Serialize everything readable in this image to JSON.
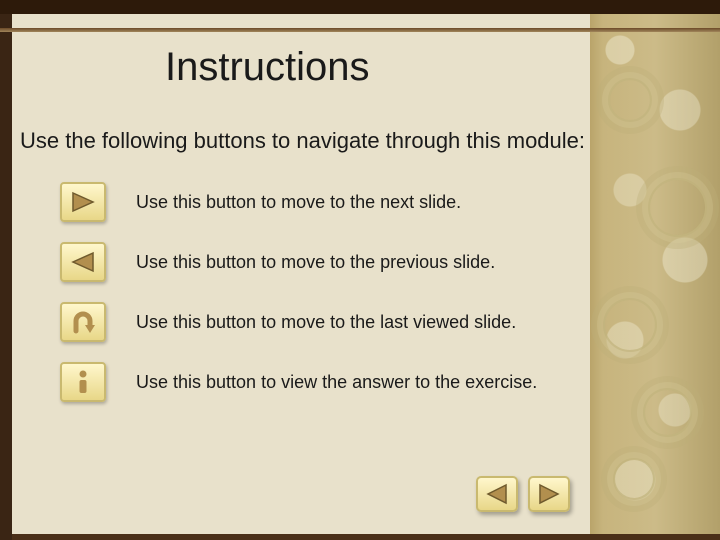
{
  "slide": {
    "title": "Instructions",
    "intro": "Use the following buttons to navigate through this module:",
    "items": [
      {
        "icon": "play-right",
        "text": "Use this button to move to the next slide."
      },
      {
        "icon": "play-left",
        "text": "Use this button to move to the previous slide."
      },
      {
        "icon": "uturn",
        "text": "Use this button to move to the last viewed slide."
      },
      {
        "icon": "info",
        "text": "Use this button to view the answer to the exercise."
      }
    ]
  },
  "nav": {
    "prev_icon": "play-left",
    "next_icon": "play-right"
  },
  "colors": {
    "accent_fill": "#b28f4e",
    "accent_stroke": "#6f5a2d",
    "button_bg_top": "#fff7cc",
    "button_bg_bottom": "#e8d788"
  }
}
